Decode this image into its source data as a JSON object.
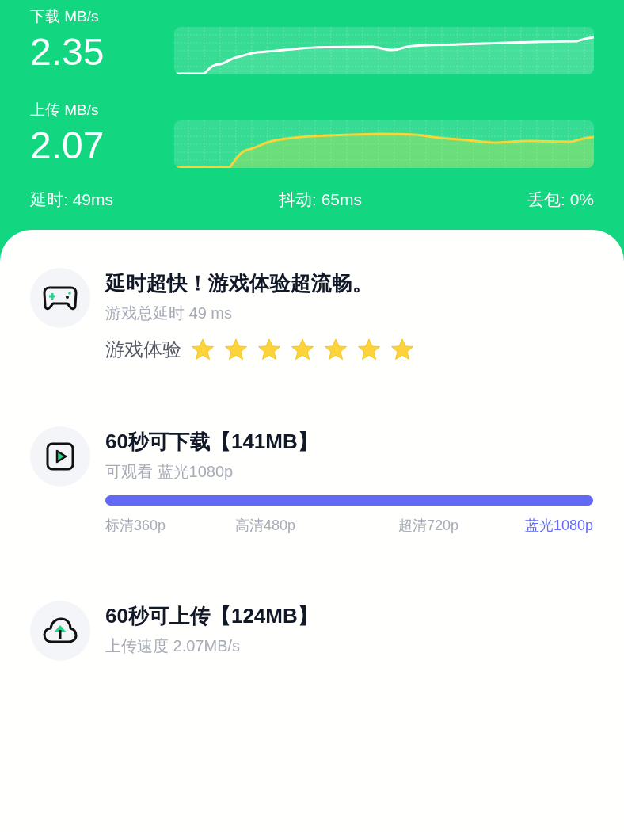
{
  "speed": {
    "download": {
      "label": "下载 MB/s",
      "value": "2.35"
    },
    "upload": {
      "label": "上传 MB/s",
      "value": "2.07"
    },
    "stats": [
      "延时: 49ms",
      "抖动: 65ms",
      "丢包: 0%"
    ]
  },
  "results": [
    {
      "kind": "game",
      "title": "延时超快！游戏体验超流畅。",
      "subtitle": "游戏总延时 49 ms",
      "rating_label": "游戏体验",
      "stars": 7
    },
    {
      "kind": "video",
      "title": "60秒可下载【141MB】",
      "subtitle": "可观看 蓝光1080p",
      "level": 1,
      "qualities": [
        {
          "label": "标清360p",
          "selected": false
        },
        {
          "label": "高清480p",
          "selected": false
        },
        {
          "label": "超清720p",
          "selected": false
        },
        {
          "label": "蓝光1080p",
          "selected": true
        }
      ]
    },
    {
      "kind": "upload",
      "title": "60秒可上传【124MB】",
      "subtitle": "上传速度 2.07MB/s"
    }
  ]
}
